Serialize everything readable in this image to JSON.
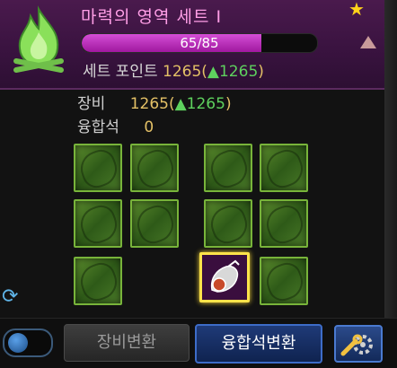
{
  "set": {
    "title": "마력의 영역 세트 I",
    "progress_text": "65/85",
    "progress": 0.765,
    "point_label": "세트 포인트",
    "point_value": "1265",
    "point_delta": "▲1265"
  },
  "stats": {
    "equip_label": "장비",
    "equip_value": "1265",
    "equip_delta": "▲1265",
    "stone_label": "융합석",
    "stone_value": "0"
  },
  "buttons": {
    "equip_change": "장비변환",
    "stone_change": "융합석변환"
  },
  "icons": {
    "star": "star-icon",
    "flame": "green-flame-icon",
    "cycle": "cycle-icon",
    "settings": "wrench-gear-icon",
    "collapse": "triangle-up-icon"
  },
  "colors": {
    "header_bg": "#3a1340",
    "title": "#ff9ee6",
    "bar_fill": "#c030c4",
    "slot_border": "#78b43a",
    "selected_border": "#ffe34a",
    "primary_button": "#1f3a78"
  }
}
